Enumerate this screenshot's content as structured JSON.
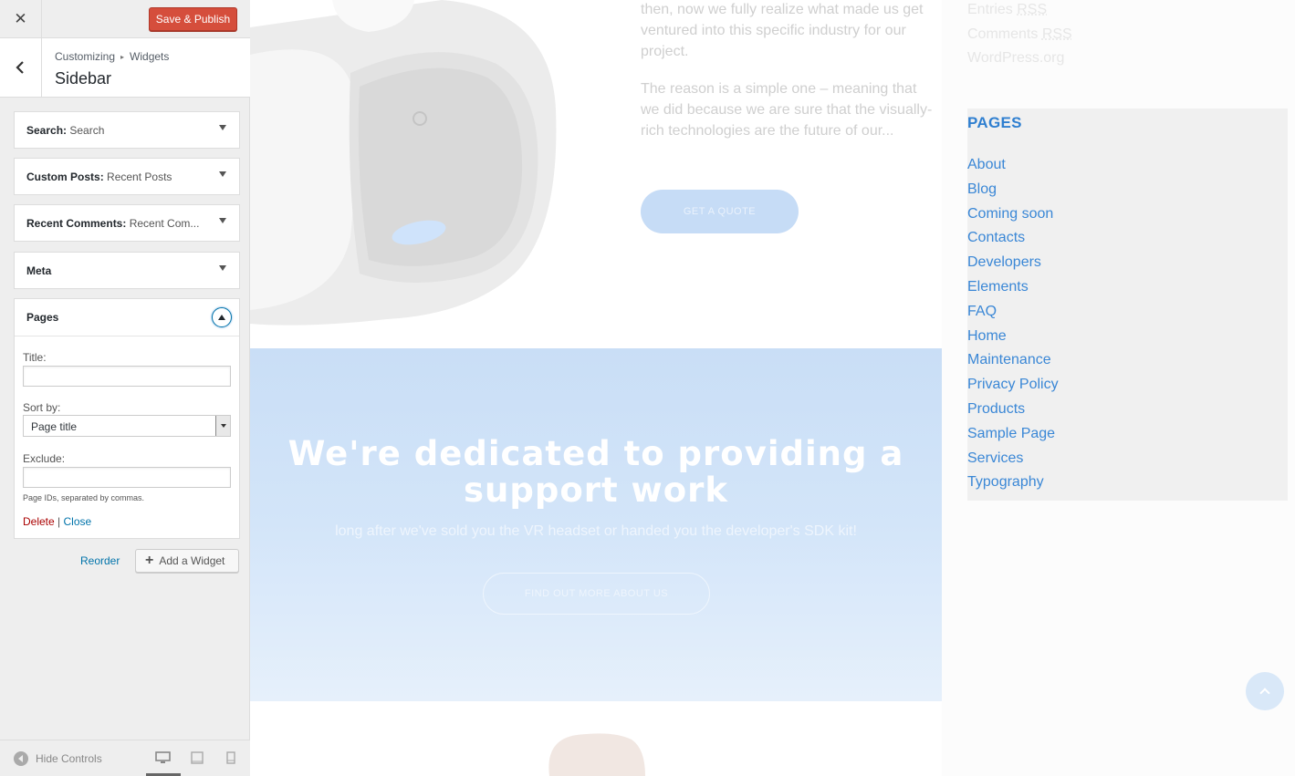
{
  "topbar": {
    "close_glyph": "✕",
    "save_label": "Save & Publish"
  },
  "section": {
    "breadcrumb": [
      "Customizing",
      "Widgets"
    ],
    "breadcrumb_sep": "▸",
    "title": "Sidebar"
  },
  "widgets": [
    {
      "type": "Search",
      "instance": "Search"
    },
    {
      "type": "Custom Posts",
      "instance": "Recent Posts"
    },
    {
      "type": "Recent Comments",
      "instance": "Recent Com..."
    },
    {
      "type": "Meta",
      "instance": ""
    }
  ],
  "pages_widget": {
    "title": "Pages",
    "title_label": "Title:",
    "title_value": "",
    "sort_label": "Sort by:",
    "sort_value": "Page title",
    "exclude_label": "Exclude:",
    "exclude_value": "",
    "exclude_hint": "Page IDs, separated by commas.",
    "delete_label": "Delete",
    "separator": "|",
    "close_label": "Close"
  },
  "actions": {
    "reorder_label": "Reorder",
    "add_widget_label": "Add a Widget",
    "add_glyph": "+"
  },
  "footer": {
    "hide_controls_label": "Hide Controls"
  },
  "preview": {
    "intro_paragraphs": [
      "then, now we fully realize what made us get ventured into this specific industry for our project.",
      "The reason is a simple one – meaning that we did because we are sure that the visually-rich technologies are the future of our..."
    ],
    "quote_button": "GET A QUOTE",
    "hero_title": "We're dedicated to providing a support work",
    "hero_subtitle": "long after we've sold you the VR headset or handed you the developer's SDK kit!",
    "hero_button": "FIND OUT MORE ABOUT US",
    "meta_links": [
      {
        "text": "Entries",
        "rss": "RSS"
      },
      {
        "text": "Comments",
        "rss": "RSS"
      },
      {
        "text": "WordPress.org",
        "rss": ""
      }
    ],
    "pages_heading": "PAGES",
    "pages": [
      "About",
      "Blog",
      "Coming soon",
      "Contacts",
      "Developers",
      "Elements",
      "FAQ",
      "Home",
      "Maintenance",
      "Privacy Policy",
      "Products",
      "Sample Page",
      "Services",
      "Typography"
    ]
  },
  "colors": {
    "save_button": "#d54e3c",
    "link_blue": "#0073aa",
    "delete_red": "#aa0000",
    "pages_link": "#3a87d6",
    "hero_bg": "#c9def6"
  },
  "icons": {
    "close": "close-icon",
    "back": "chevron-left-icon",
    "collapse": "chevron-up-icon",
    "select_dropdown": "chevron-down-icon",
    "add": "plus-icon",
    "hide_controls": "collapse-arrow-icon",
    "devices": [
      "desktop-icon",
      "tablet-icon",
      "mobile-icon"
    ],
    "scroll_top": "arrow-up-icon"
  }
}
